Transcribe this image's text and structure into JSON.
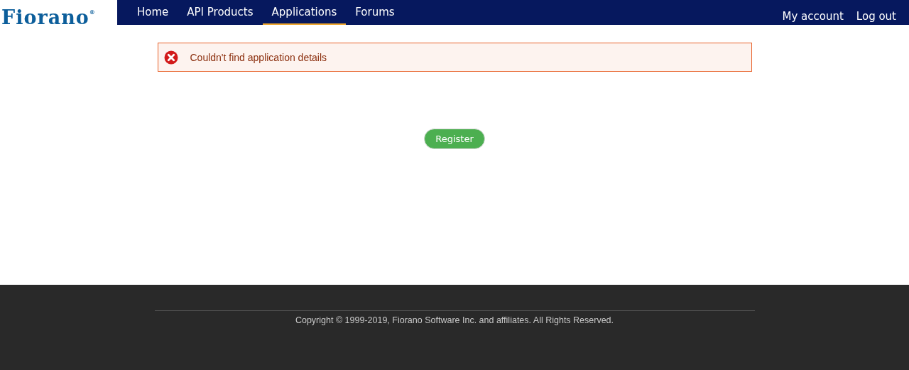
{
  "logo": {
    "text": "Fiorano$^{®}$"
  },
  "nav": {
    "items": [
      {
        "label": "Home",
        "selected": false
      },
      {
        "label": "API Products",
        "selected": false
      },
      {
        "label": "Applications",
        "selected": true
      },
      {
        "label": "Forums",
        "selected": false
      }
    ],
    "account_links": [
      "My account",
      "Log out"
    ]
  },
  "alert": {
    "kind": "error",
    "message": "Couldn't find application details"
  },
  "register_button": "Register",
  "footer": {
    "copyright": "Copyright © 1999-2019, Fiorano Software Inc. and affiliates. All Rights Reserved."
  }
}
